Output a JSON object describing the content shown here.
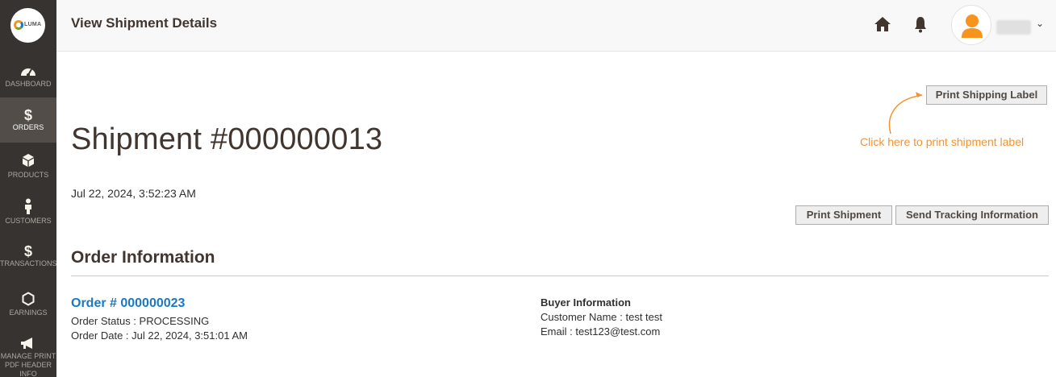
{
  "brand": {
    "logo_text": "LUMA"
  },
  "sidebar": {
    "items": [
      {
        "label": "DASHBOARD",
        "icon": "dashboard-icon"
      },
      {
        "label": "ORDERS",
        "icon": "dollar-icon",
        "active": true
      },
      {
        "label": "PRODUCTS",
        "icon": "box-icon"
      },
      {
        "label": "CUSTOMERS",
        "icon": "person-icon"
      },
      {
        "label": "TRANSACTIONS",
        "icon": "dollar-icon"
      },
      {
        "label": "EARNINGS",
        "icon": "hexagon-icon"
      },
      {
        "label_lines": [
          "MANAGE PRINT",
          "PDF HEADER",
          "INFO"
        ],
        "icon": "megaphone-icon"
      }
    ]
  },
  "header": {
    "title": "View Shipment Details",
    "icons": [
      "home-icon",
      "bell-icon",
      "user-avatar-icon",
      "chevron-down-icon"
    ]
  },
  "main": {
    "page_title": "Shipment #000000013",
    "shipment_date": "Jul 22, 2024, 3:52:23 AM",
    "buttons": {
      "print_shipping_label": "Print Shipping Label",
      "print_shipment": "Print Shipment",
      "send_tracking": "Send Tracking Information"
    },
    "annotation": "Click here to print shipment label",
    "order_information": {
      "section_title": "Order Information",
      "order_link": "Order # 000000023",
      "order_status": "Order Status : PROCESSING",
      "order_date": "Order Date : Jul 22, 2024, 3:51:01 AM"
    },
    "buyer_information": {
      "title": "Buyer Information",
      "customer_name": "Customer Name : test test",
      "email": "Email : test123@test.com"
    }
  },
  "colors": {
    "sidebar_bg": "#373330",
    "sidebar_active": "#524d49",
    "link": "#1979c3",
    "annotation": "#f39331",
    "avatar": "#f7941d"
  }
}
